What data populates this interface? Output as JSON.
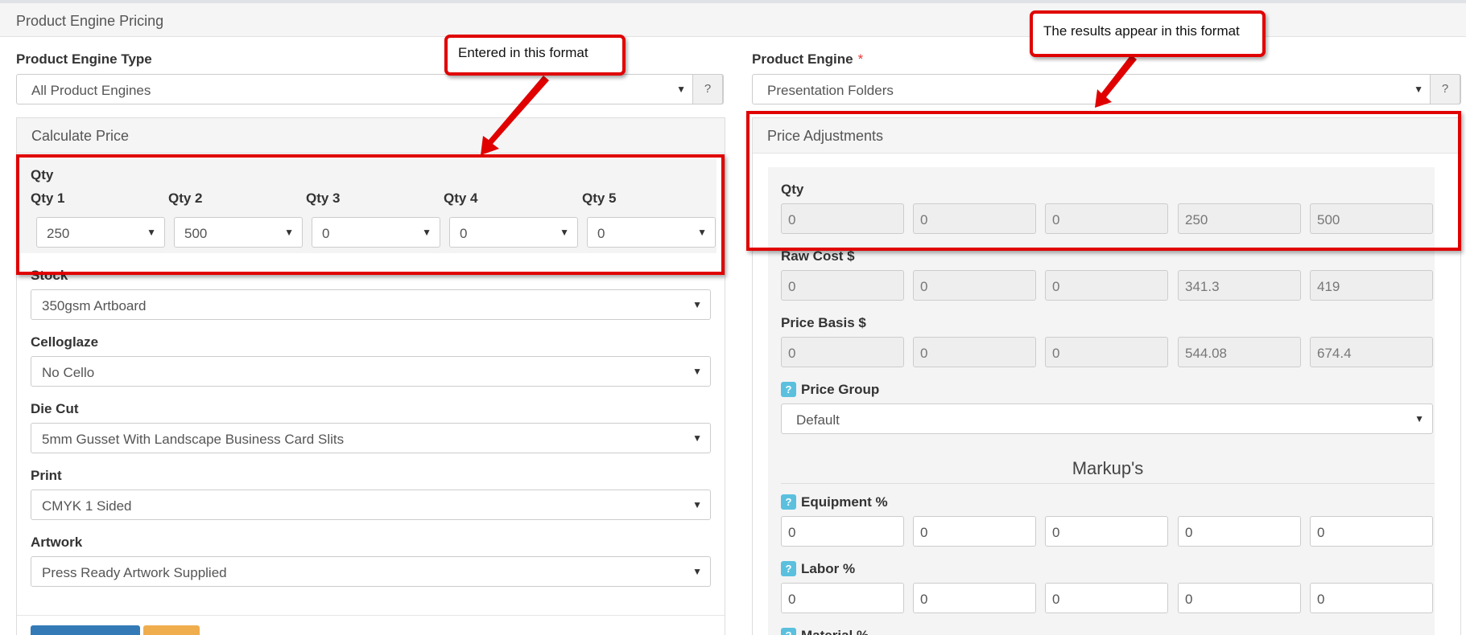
{
  "panel": {
    "title": "Product Engine Pricing"
  },
  "engine_type": {
    "label": "Product Engine Type",
    "value": "All Product Engines",
    "help": "?"
  },
  "engine": {
    "label": "Product Engine",
    "required": "*",
    "value": "Presentation Folders",
    "help": "?"
  },
  "calculate": {
    "title": "Calculate Price",
    "qty_label": "Qty",
    "qty": [
      {
        "label": "Qty 1",
        "value": "250"
      },
      {
        "label": "Qty 2",
        "value": "500"
      },
      {
        "label": "Qty 3",
        "value": "0"
      },
      {
        "label": "Qty 4",
        "value": "0"
      },
      {
        "label": "Qty 5",
        "value": "0"
      }
    ],
    "fields": {
      "stock": {
        "label": "Stock",
        "value": "350gsm Artboard"
      },
      "celloglaze": {
        "label": "Celloglaze",
        "value": "No Cello"
      },
      "diecut": {
        "label": "Die Cut",
        "value": "5mm Gusset With Landscape Business Card Slits"
      },
      "print": {
        "label": "Print",
        "value": "CMYK 1 Sided"
      },
      "artwork": {
        "label": "Artwork",
        "value": "Press Ready Artwork Supplied"
      }
    }
  },
  "adjustments": {
    "title": "Price Adjustments",
    "qty": {
      "label": "Qty",
      "values": [
        "0",
        "0",
        "0",
        "250",
        "500"
      ]
    },
    "raw_cost": {
      "label": "Raw Cost $",
      "values": [
        "0",
        "0",
        "0",
        "341.3",
        "419"
      ]
    },
    "price_basis": {
      "label": "Price Basis $",
      "values": [
        "0",
        "0",
        "0",
        "544.08",
        "674.4"
      ]
    },
    "price_group": {
      "label": "Price Group",
      "value": "Default"
    },
    "markups_title": "Markup's",
    "equipment": {
      "label": "Equipment %",
      "values": [
        "0",
        "0",
        "0",
        "0",
        "0"
      ]
    },
    "labor": {
      "label": "Labor %",
      "values": [
        "0",
        "0",
        "0",
        "0",
        "0"
      ]
    },
    "material": {
      "label": "Material %"
    }
  },
  "annotations": {
    "left": "Entered in this format",
    "right": "The results appear in this format"
  },
  "colors": {
    "annotation_red": "#e00000",
    "help_blue": "#5bc0de",
    "primary_button": "#337ab7",
    "warning_button": "#f0ad4e"
  }
}
